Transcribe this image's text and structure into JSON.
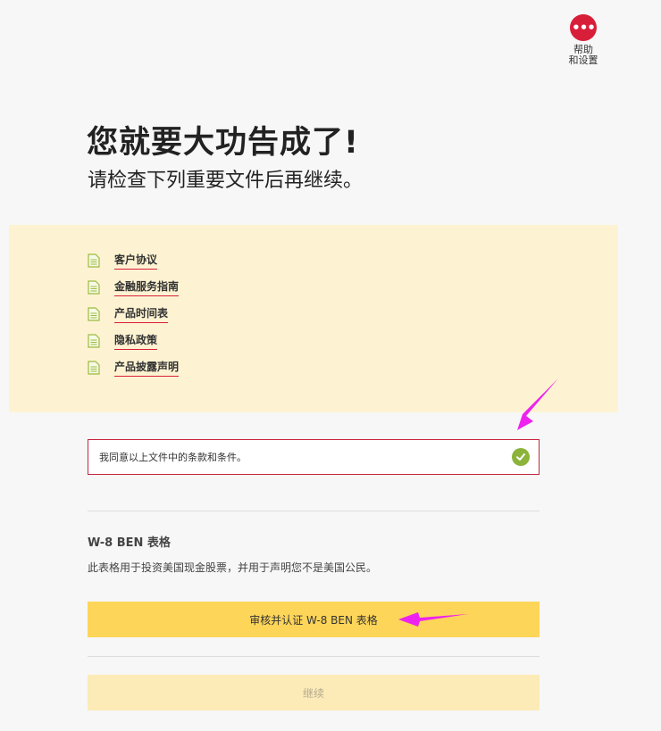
{
  "help": {
    "icon": "more-dots-icon",
    "label_line1": "帮助",
    "label_line2": "和设置",
    "color": "#d81f3a"
  },
  "header": {
    "title": "您就要大功告成了!",
    "subtitle": "请检查下列重要文件后再继续。"
  },
  "documents": [
    {
      "label": "客户协议",
      "icon": "document-icon"
    },
    {
      "label": "金融服务指南",
      "icon": "document-icon"
    },
    {
      "label": "产品时间表",
      "icon": "document-icon"
    },
    {
      "label": "隐私政策",
      "icon": "document-icon"
    },
    {
      "label": "产品披露声明",
      "icon": "document-icon"
    }
  ],
  "agreement": {
    "text": "我同意以上文件中的条款和条件。",
    "checked": true,
    "check_color": "#8cb33a"
  },
  "w8": {
    "title": "W-8 BEN 表格",
    "description": "此表格用于投资美国现金股票，并用于声明您不是美国公民。",
    "button_label": "审核并认证 W-8 BEN 表格"
  },
  "continue_label": "继续",
  "colors": {
    "accent": "#d81f3a",
    "primary_button": "#fdd558",
    "panel": "#fdf3d2",
    "annotation": "#ee22ee"
  }
}
